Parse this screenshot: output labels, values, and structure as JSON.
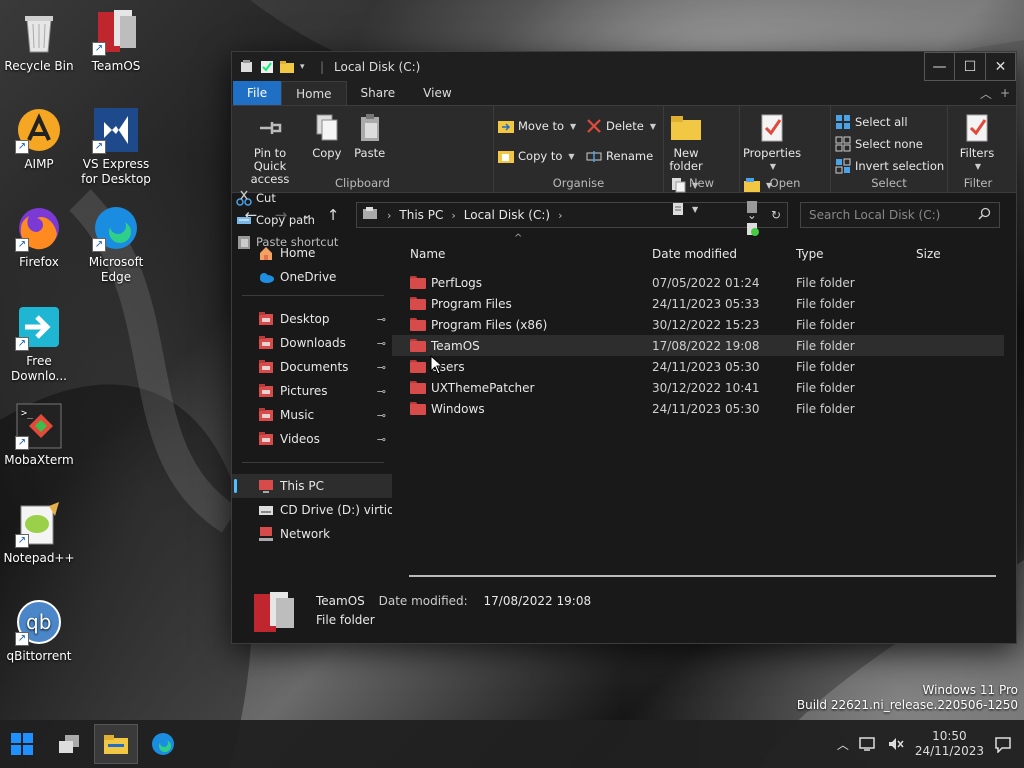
{
  "desktop": {
    "icons": [
      {
        "label": "Recycle Bin",
        "icon": "recycle-bin-icon"
      },
      {
        "label": "TeamOS",
        "icon": "teamos-icon"
      },
      {
        "label": "AIMP",
        "icon": "aimp-icon"
      },
      {
        "label": "VS Express for Desktop",
        "icon": "visual-studio-icon"
      },
      {
        "label": "Firefox",
        "icon": "firefox-icon"
      },
      {
        "label": "Microsoft Edge",
        "icon": "edge-icon"
      },
      {
        "label": "Free Downlo...",
        "icon": "free-download-manager-icon"
      },
      {
        "label": "MobaXterm",
        "icon": "mobaxterm-icon"
      },
      {
        "label": "Notepad++",
        "icon": "notepadpp-icon"
      },
      {
        "label": "qBittorrent",
        "icon": "qbittorrent-icon"
      }
    ]
  },
  "window": {
    "title": "Local Disk (C:)",
    "controls": {
      "minimize": "—",
      "maximize": "☐",
      "close": "✕"
    }
  },
  "ribbon": {
    "tabs": [
      {
        "label": "File",
        "state": "file"
      },
      {
        "label": "Home",
        "state": "active"
      },
      {
        "label": "Share",
        "state": ""
      },
      {
        "label": "View",
        "state": ""
      }
    ],
    "clipboard": {
      "name": "Clipboard",
      "pin": "Pin to Quick access",
      "copy": "Copy",
      "paste": "Paste",
      "cut": "Cut",
      "copy_path": "Copy path",
      "paste_shortcut": "Paste shortcut"
    },
    "organise": {
      "name": "Organise",
      "move_to": "Move to",
      "copy_to": "Copy to",
      "delete": "Delete",
      "rename": "Rename"
    },
    "new": {
      "name": "New",
      "new_folder": "New folder"
    },
    "open": {
      "name": "Open",
      "properties": "Properties"
    },
    "select": {
      "name": "Select",
      "select_all": "Select all",
      "select_none": "Select none",
      "invert": "Invert selection"
    },
    "filter": {
      "name": "Filter",
      "filters": "Filters"
    }
  },
  "address": {
    "crumbs": [
      "This PC",
      "Local Disk (C:)"
    ],
    "search_placeholder": "Search Local Disk (C:)"
  },
  "navpane": {
    "top": [
      {
        "label": "Home",
        "icon": "home-icon"
      },
      {
        "label": "OneDrive",
        "icon": "onedrive-icon"
      }
    ],
    "quick": [
      {
        "label": "Desktop",
        "icon": "desktop-icon"
      },
      {
        "label": "Downloads",
        "icon": "downloads-icon"
      },
      {
        "label": "Documents",
        "icon": "documents-icon"
      },
      {
        "label": "Pictures",
        "icon": "pictures-icon"
      },
      {
        "label": "Music",
        "icon": "music-icon"
      },
      {
        "label": "Videos",
        "icon": "videos-icon"
      }
    ],
    "devices": [
      {
        "label": "This PC",
        "icon": "this-pc-icon",
        "selected": true
      },
      {
        "label": "CD Drive (D:) virtio-w",
        "icon": "cd-drive-icon",
        "selected": false
      },
      {
        "label": "Network",
        "icon": "network-icon",
        "selected": false
      }
    ]
  },
  "columns": {
    "name": "Name",
    "date": "Date modified",
    "type": "Type",
    "size": "Size"
  },
  "files": [
    {
      "name": "PerfLogs",
      "date": "07/05/2022 01:24",
      "type": "File folder"
    },
    {
      "name": "Program Files",
      "date": "24/11/2023 05:33",
      "type": "File folder"
    },
    {
      "name": "Program Files (x86)",
      "date": "30/12/2022 15:23",
      "type": "File folder"
    },
    {
      "name": "TeamOS",
      "date": "17/08/2022 19:08",
      "type": "File folder",
      "hover": true
    },
    {
      "name": "Users",
      "date": "24/11/2023 05:30",
      "type": "File folder"
    },
    {
      "name": "UXThemePatcher",
      "date": "30/12/2022 10:41",
      "type": "File folder"
    },
    {
      "name": "Windows",
      "date": "24/11/2023 05:30",
      "type": "File folder"
    }
  ],
  "details": {
    "name": "TeamOS",
    "date_label": "Date modified:",
    "date_value": "17/08/2022 19:08",
    "type": "File folder"
  },
  "watermark": {
    "line1": "Windows 11 Pro",
    "line2": "Build 22621.ni_release.220506-1250"
  },
  "taskbar": {
    "time": "10:50",
    "date": "24/11/2023"
  }
}
